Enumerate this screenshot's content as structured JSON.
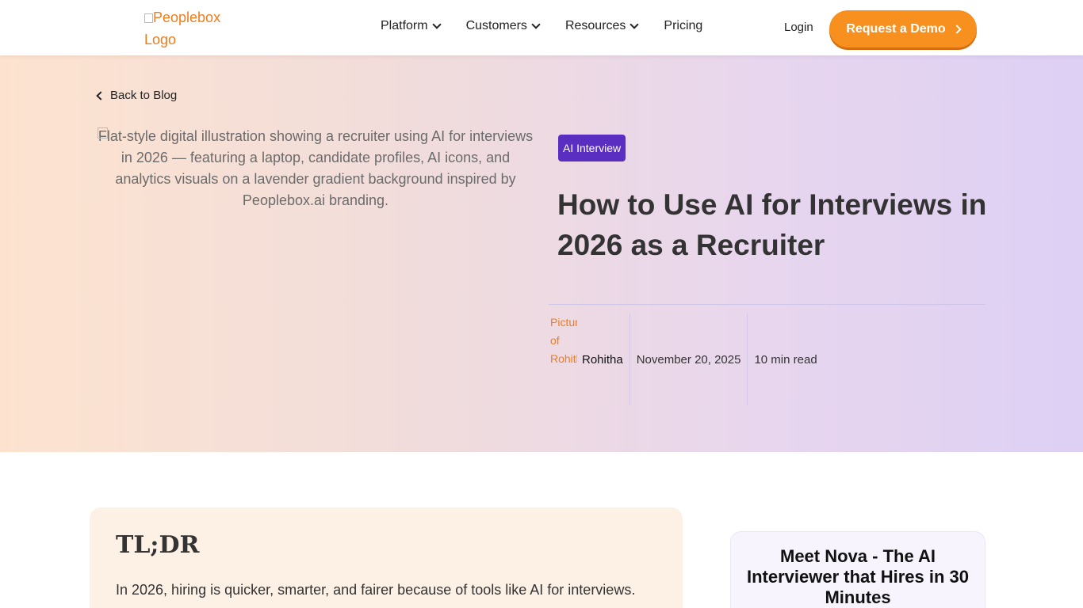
{
  "header": {
    "logo_alt": "Peoplebox Logo",
    "nav": [
      {
        "label": "Platform",
        "has_dropdown": true
      },
      {
        "label": "Customers",
        "has_dropdown": true
      },
      {
        "label": "Resources",
        "has_dropdown": true
      },
      {
        "label": "Pricing",
        "has_dropdown": false
      }
    ],
    "login_label": "Login",
    "demo_label": "Request a Demo"
  },
  "hero": {
    "back_label": "Back to Blog",
    "image_alt": "Flat-style digital illustration showing a recruiter using AI for interviews in 2026 — featuring a laptop, candidate profiles, AI icons, and analytics visuals on a lavender gradient background inspired by Peoplebox.ai branding.",
    "tag": "AI Interview",
    "title": "How to Use AI for Interviews in 2026 as a Recruiter",
    "author_avatar_alt": "Picture of Rohitha",
    "author": "Rohitha",
    "date": "November 20, 2025",
    "read_time": "10 min read"
  },
  "tldr": {
    "heading": "TL;DR",
    "text": "In 2026, hiring is quicker, smarter, and fairer because of tools like AI for interviews."
  },
  "sidebar": {
    "card_title": "Meet Nova - The AI Interviewer that Hires in 30 Minutes"
  },
  "colors": {
    "accent_orange": "#f7901e",
    "tag_purple": "#5b2ec2"
  }
}
